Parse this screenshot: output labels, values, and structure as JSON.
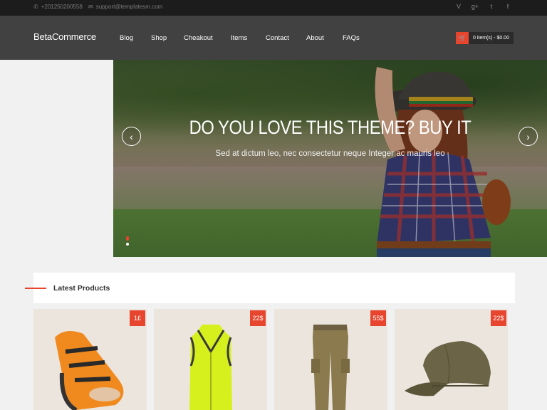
{
  "topbar": {
    "phone": "+201250200558",
    "email": "support@templatesm.com",
    "social": [
      "vine-icon",
      "google-plus-icon",
      "twitter-icon",
      "facebook-icon"
    ]
  },
  "header": {
    "logo": "BetaCommerce",
    "nav": [
      "Blog",
      "Shop",
      "Cheakout",
      "Items",
      "Contact",
      "About",
      "FAQs"
    ],
    "cart": "0 item(s) - $0.00"
  },
  "hero": {
    "title": "DO YOU LOVE THIS THEME? BUY IT",
    "subtitle": "Sed at dictum leo, nec consectetur neque Integer ac mauris leo",
    "prev": "‹",
    "next": "›"
  },
  "latest": {
    "title": "Latest Products"
  },
  "products": [
    {
      "price": "1£",
      "icon": "cycling-shoe"
    },
    {
      "price": "22$",
      "icon": "cycling-vest"
    },
    {
      "price": "55$",
      "icon": "cargo-pants"
    },
    {
      "price": "22$",
      "icon": "cap"
    }
  ],
  "colors": {
    "accent": "#e8452e",
    "header": "#323232",
    "topbar": "#1c1c1c"
  }
}
